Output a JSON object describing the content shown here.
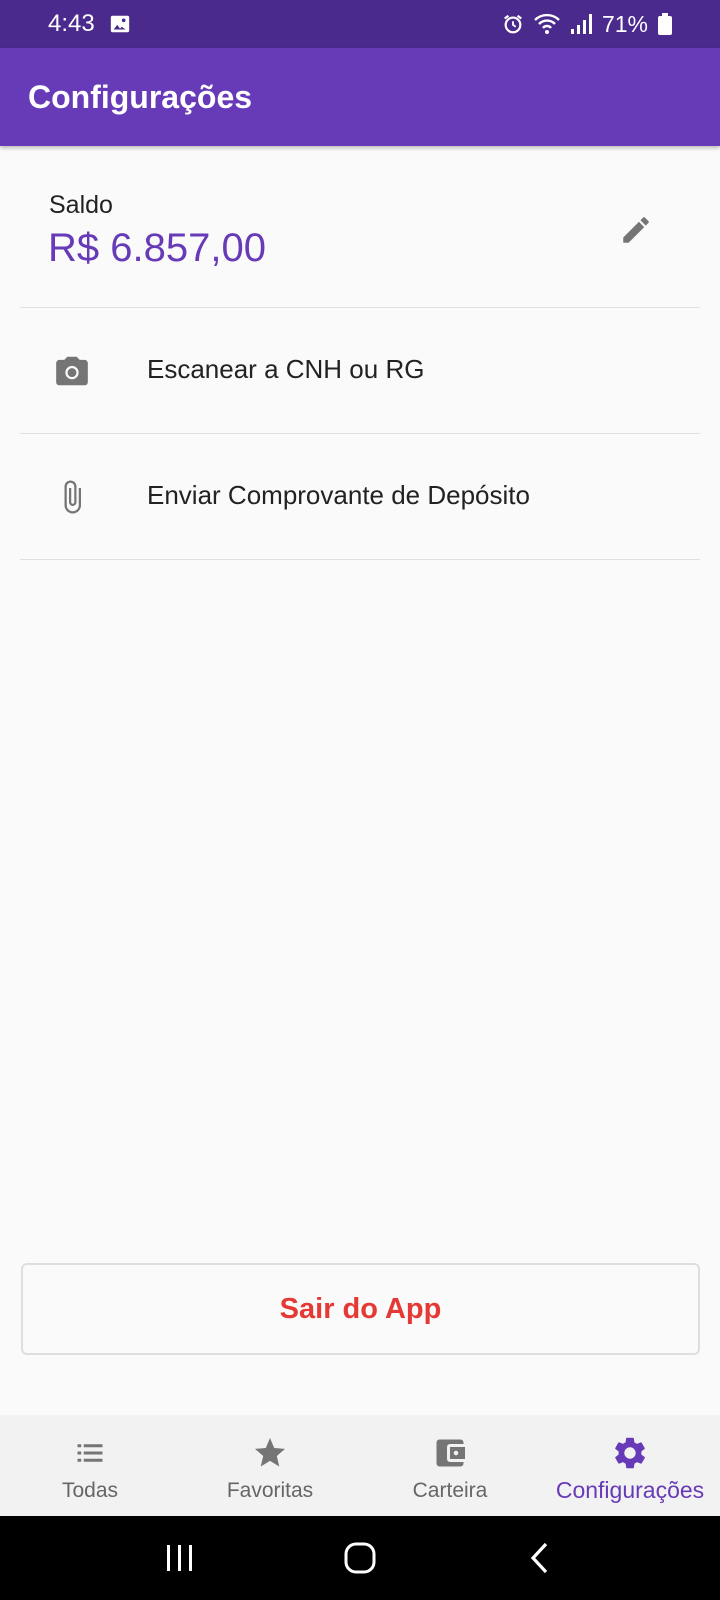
{
  "status_bar": {
    "time": "4:43",
    "battery": "71%",
    "icons": [
      "gallery-icon",
      "alarm-icon",
      "wifi-icon",
      "signal-icon",
      "battery-icon"
    ]
  },
  "app_bar": {
    "title": "Configurações"
  },
  "balance": {
    "label": "Saldo",
    "value": "R$ 6.857,00",
    "edit_icon": "pencil-icon"
  },
  "menu": {
    "items": [
      {
        "label": "Escanear a CNH ou RG",
        "icon": "camera-icon"
      },
      {
        "label": "Enviar Comprovante de Depósito",
        "icon": "paperclip-icon"
      }
    ]
  },
  "logout": {
    "label": "Sair do App"
  },
  "bottom_nav": {
    "items": [
      {
        "label": "Todas",
        "icon": "list-icon",
        "active": false
      },
      {
        "label": "Favoritas",
        "icon": "star-icon",
        "active": false
      },
      {
        "label": "Carteira",
        "icon": "wallet-icon",
        "active": false
      },
      {
        "label": "Configurações",
        "icon": "gear-icon",
        "active": true
      }
    ]
  },
  "colors": {
    "primary": "#673ab7",
    "status_bar": "#4a2a8c",
    "logout_text": "#e53935",
    "icon_grey": "#757575"
  }
}
